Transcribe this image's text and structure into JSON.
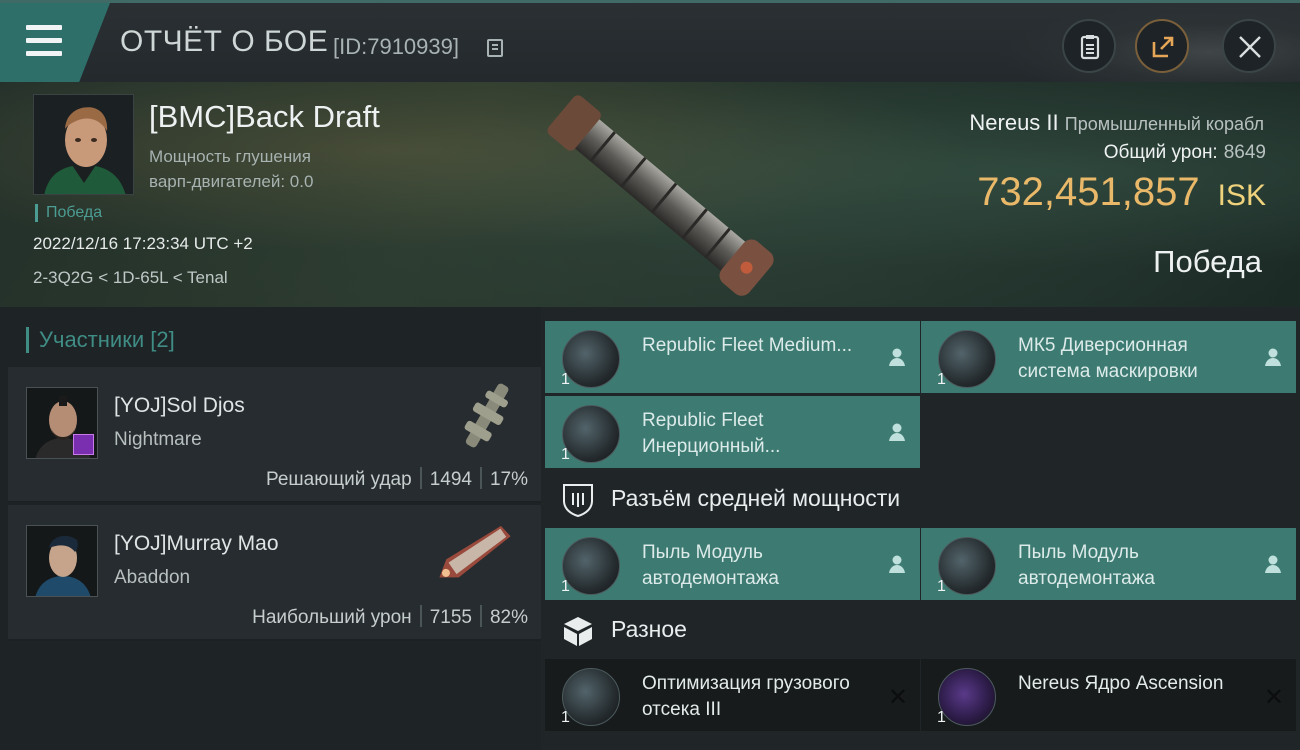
{
  "header": {
    "title": "ОТЧЁТ О БОЕ",
    "report_id": "[ID:7910939]"
  },
  "victim": {
    "pilot": "[BMC]Back Draft",
    "jam_label": "Мощность глушения",
    "jam_value": "варп-двигателей: 0.0",
    "result_tag": "Победа",
    "datetime": "2022/12/16 17:23:34 UTC +2",
    "location": "2-3Q2G < 1D-65L < Tenal",
    "ship_name": "Nereus II",
    "ship_class": "Промышленный корабл",
    "damage_label": "Общий урон:",
    "damage_value": "8649",
    "isk_value": "732,451,857",
    "isk_currency": "ISK",
    "result_big": "Победа"
  },
  "participants": {
    "header": "Участники",
    "count": "[2]",
    "list": [
      {
        "name": "[YOJ]Sol Djos",
        "ship": "Nightmare",
        "role": "Решающий удар",
        "damage": "1494",
        "percent": "17%"
      },
      {
        "name": "[YOJ]Murray Mao",
        "ship": "Abaddon",
        "role": "Наибольший урон",
        "damage": "7155",
        "percent": "82%"
      }
    ]
  },
  "items": {
    "low_slots": [
      {
        "name": "Republic Fleet Medium...",
        "qty": "1"
      },
      {
        "name": "МК5 Диверсионная система маскировки",
        "qty": "1"
      },
      {
        "name": "Republic Fleet Инерционный...",
        "qty": "1"
      }
    ],
    "mid_header": "Разъём средней мощности",
    "mid_slots": [
      {
        "name": "Пыль Модуль автодемонтажа",
        "qty": "1"
      },
      {
        "name": "Пыль Модуль автодемонтажа",
        "qty": "1"
      }
    ],
    "misc_header": "Разное",
    "misc": [
      {
        "name": "Оптимизация грузового отсека III",
        "qty": "1"
      },
      {
        "name": "Nereus Ядро Ascension",
        "qty": "1"
      }
    ]
  },
  "colors": {
    "accent_teal": "#3d7a72",
    "isk_gold": "#e9b969",
    "header_teal": "#3f8d85"
  }
}
